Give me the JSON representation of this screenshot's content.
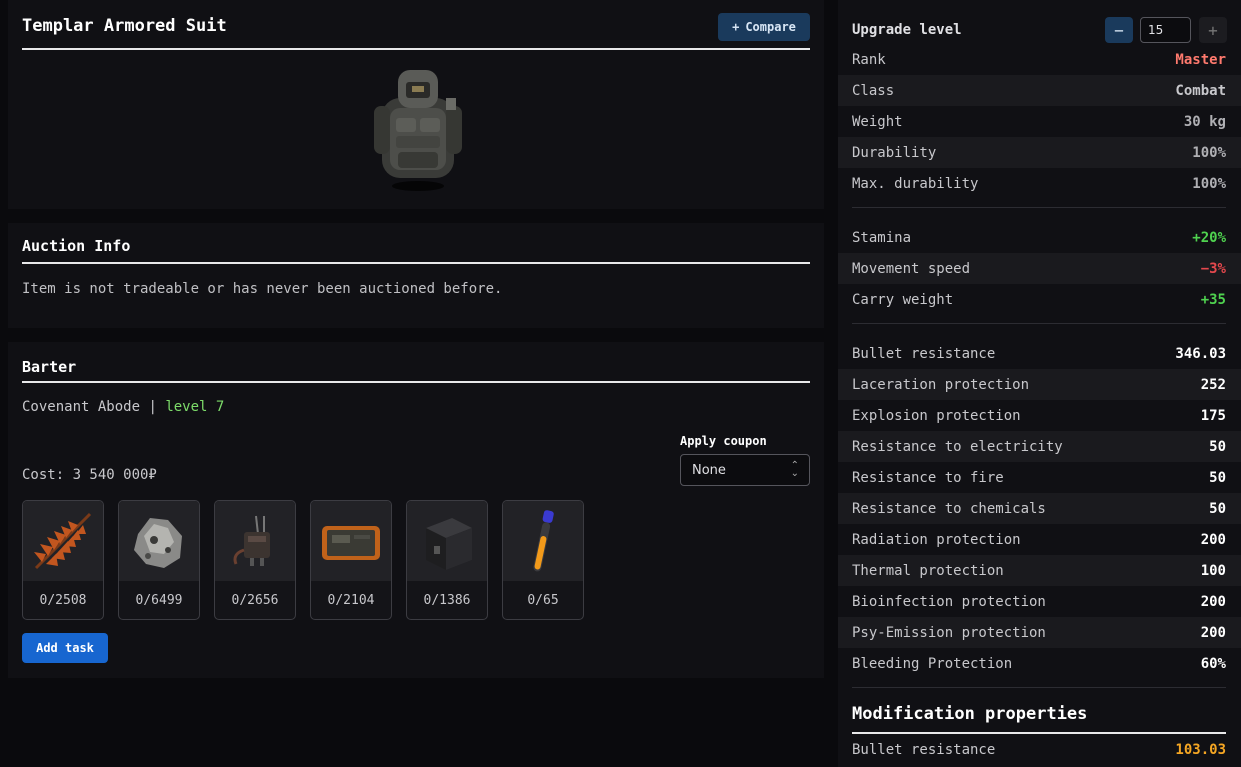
{
  "item": {
    "title": "Templar Armored Suit",
    "compare_label": "Compare"
  },
  "auction": {
    "title": "Auction Info",
    "text": "Item is not tradeable or has never been auctioned before."
  },
  "barter": {
    "title": "Barter",
    "vendor": "Covenant Abode",
    "separator": "|",
    "level": "level 7",
    "coupon_label": "Apply coupon",
    "coupon_value": "None",
    "cost": "Cost: 3 540 000₽",
    "items": [
      {
        "icon": "fern-icon",
        "qty": "0/2508"
      },
      {
        "icon": "ore-rock-icon",
        "qty": "0/6499"
      },
      {
        "icon": "device-icon",
        "qty": "0/2656"
      },
      {
        "icon": "tablet-icon",
        "qty": "0/2104"
      },
      {
        "icon": "battery-icon",
        "qty": "0/1386"
      },
      {
        "icon": "vial-icon",
        "qty": "0/65"
      }
    ],
    "add_task_label": "Add task"
  },
  "stats": {
    "upgrade_label": "Upgrade level",
    "upgrade_value": "15",
    "colors": {
      "rank": "#ff7a6e",
      "positive": "#4fd24f",
      "negative": "#e5484d",
      "mod": "#f5a623",
      "muted": "#b0b0b4"
    },
    "rows": [
      {
        "label": "Rank",
        "value": "Master"
      },
      {
        "label": "Class",
        "value": "Combat"
      },
      {
        "label": "Weight",
        "value": "30 kg"
      },
      {
        "label": "Durability",
        "value": "100%"
      },
      {
        "label": "Max. durability",
        "value": "100%"
      }
    ],
    "bonuses": [
      {
        "label": "Stamina",
        "value": "+20%"
      },
      {
        "label": "Movement speed",
        "value": "−3%"
      },
      {
        "label": "Carry weight",
        "value": "+35"
      }
    ],
    "protections": [
      {
        "label": "Bullet resistance",
        "value": "346.03"
      },
      {
        "label": "Laceration protection",
        "value": "252"
      },
      {
        "label": "Explosion protection",
        "value": "175"
      },
      {
        "label": "Resistance to electricity",
        "value": "50"
      },
      {
        "label": "Resistance to fire",
        "value": "50"
      },
      {
        "label": "Resistance to chemicals",
        "value": "50"
      },
      {
        "label": "Radiation protection",
        "value": "200"
      },
      {
        "label": "Thermal protection",
        "value": "100"
      },
      {
        "label": "Bioinfection protection",
        "value": "200"
      },
      {
        "label": "Psy-Emission protection",
        "value": "200"
      },
      {
        "label": "Bleeding Protection",
        "value": "60%"
      }
    ],
    "mod_title": "Modification properties",
    "mods": [
      {
        "label": "Bullet resistance",
        "value": "103.03"
      }
    ]
  }
}
